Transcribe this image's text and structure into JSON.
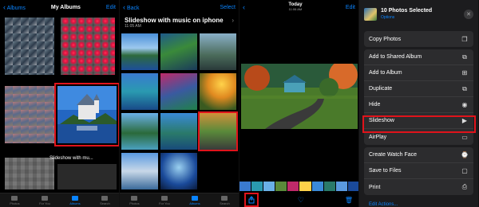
{
  "albums_screen": {
    "back": "Albums",
    "title": "My Albums",
    "edit": "Edit",
    "album_caption": "Slideshow with mu...",
    "tabs": [
      "Photos",
      "For You",
      "Albums",
      "Search"
    ],
    "active_tab": "Albums"
  },
  "album_screen": {
    "back": "Back",
    "title": "Slideshow with music on iphone",
    "select": "Select",
    "time": "11:05 AM",
    "tabs": [
      "Photos",
      "For You",
      "Albums",
      "Search"
    ],
    "active_tab": "Albums"
  },
  "photo_screen": {
    "date": "Today",
    "time": "11:06 AM",
    "edit": "Edit"
  },
  "share_sheet": {
    "title": "10 Photos Selected",
    "options": "Options",
    "groups": [
      [
        {
          "label": "Copy Photos",
          "icon": "copy-icon"
        }
      ],
      [
        {
          "label": "Add to Shared Album",
          "icon": "shared-album-icon"
        },
        {
          "label": "Add to Album",
          "icon": "add-album-icon"
        },
        {
          "label": "Duplicate",
          "icon": "duplicate-icon"
        },
        {
          "label": "Hide",
          "icon": "eye-icon"
        },
        {
          "label": "Slideshow",
          "icon": "play-icon"
        },
        {
          "label": "AirPlay",
          "icon": "airplay-icon"
        }
      ],
      [
        {
          "label": "Create Watch Face",
          "icon": "watch-icon"
        },
        {
          "label": "Save to Files",
          "icon": "folder-icon"
        },
        {
          "label": "Print",
          "icon": "print-icon"
        }
      ]
    ],
    "footer": "Edit Actions..."
  },
  "colors": {
    "accent": "#0a84ff",
    "highlight": "#e0131b"
  }
}
